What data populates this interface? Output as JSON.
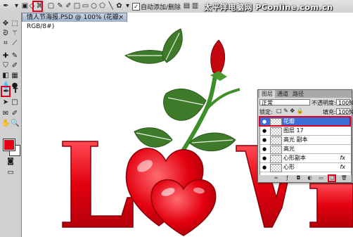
{
  "options_bar": {
    "auto_add_delete_label": "自动添加/删除",
    "auto_add_delete_checked": "✓"
  },
  "watermark": "太平洋电脑网 PConline.com.cn",
  "document_tab": {
    "title": "情人节海报.PSD @ 100% (花瓣, RGB/8#)",
    "close": "×"
  },
  "canvas_text": {
    "word": "LOVE"
  },
  "colors": {
    "foreground": "#e30014",
    "background": "#ffffff",
    "highlight": "#e0001b",
    "active_layer": "#3a6fd8"
  },
  "layers_panel": {
    "tabs": [
      "图层",
      "通道",
      "路径"
    ],
    "blend_mode": "正常",
    "opacity_label": "不透明度:",
    "opacity_value": "100%",
    "lock_label": "锁定:",
    "fill_label": "填充:",
    "fill_value": "100%",
    "layers": [
      {
        "name": "花瓣",
        "fx": "",
        "active": true
      },
      {
        "name": "图层 17",
        "fx": "",
        "active": false
      },
      {
        "name": "高光 副本",
        "fx": "",
        "active": false
      },
      {
        "name": "高光",
        "fx": "",
        "active": false
      },
      {
        "name": "心形副本",
        "fx": "fx",
        "active": false
      },
      {
        "name": "心形",
        "fx": "fx",
        "active": false
      }
    ]
  }
}
